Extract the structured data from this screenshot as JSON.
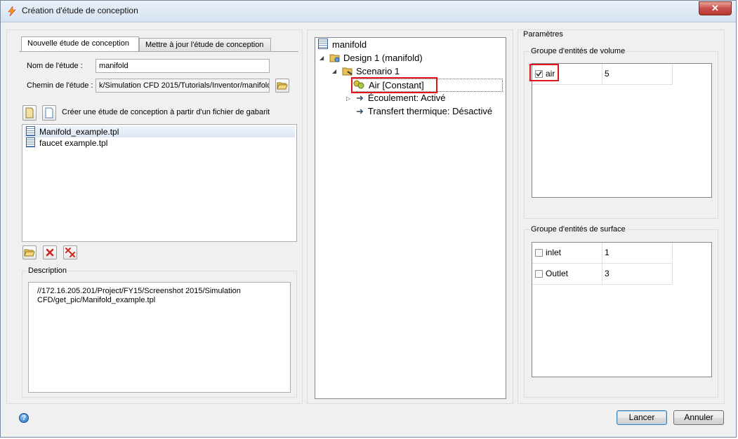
{
  "window": {
    "title": "Création d'étude de conception",
    "close_label": "✕"
  },
  "tabs": [
    {
      "label": "Nouvelle étude de conception",
      "active": true
    },
    {
      "label": "Mettre à jour l'étude de conception",
      "active": false
    }
  ],
  "form": {
    "study_name_label": "Nom de l'étude :",
    "study_name_value": "manifold",
    "study_path_label": "Chemin de l'étude :",
    "study_path_value": "k/Simulation CFD 2015/Tutorials/Inventor/manifold",
    "template_hint": "Créer une étude de conception à partir d'un fichier de gabarit"
  },
  "template_list": [
    {
      "name": "Manifold_example.tpl",
      "selected": true
    },
    {
      "name": "faucet example.tpl",
      "selected": false
    }
  ],
  "description": {
    "title": "Description",
    "text": "//172.16.205.201/Project/FY15/Screenshot 2015/Simulation CFD/get_pic/Manifold_example.tpl"
  },
  "tree": {
    "root": "manifold",
    "design": "Design 1 (manifold)",
    "scenario": "Scenario 1",
    "material": "Air [Constant]",
    "flow": "Écoulement: Activé",
    "heat": "Transfert thermique: Désactivé"
  },
  "params": {
    "title": "Paramètres",
    "volume_group": {
      "title": "Groupe d'entités de volume",
      "rows": [
        {
          "name": "air",
          "value": "5",
          "checked": true
        }
      ]
    },
    "surface_group": {
      "title": "Groupe d'entités de surface",
      "rows": [
        {
          "name": "inlet",
          "value": "1",
          "checked": false
        },
        {
          "name": "Outlet",
          "value": "3",
          "checked": false
        }
      ]
    }
  },
  "footer": {
    "help_icon_label": "?",
    "launch_label": "Lancer",
    "cancel_label": "Annuler"
  },
  "colors": {
    "highlight": "#e2141c",
    "accent": "#3c7fb1"
  }
}
